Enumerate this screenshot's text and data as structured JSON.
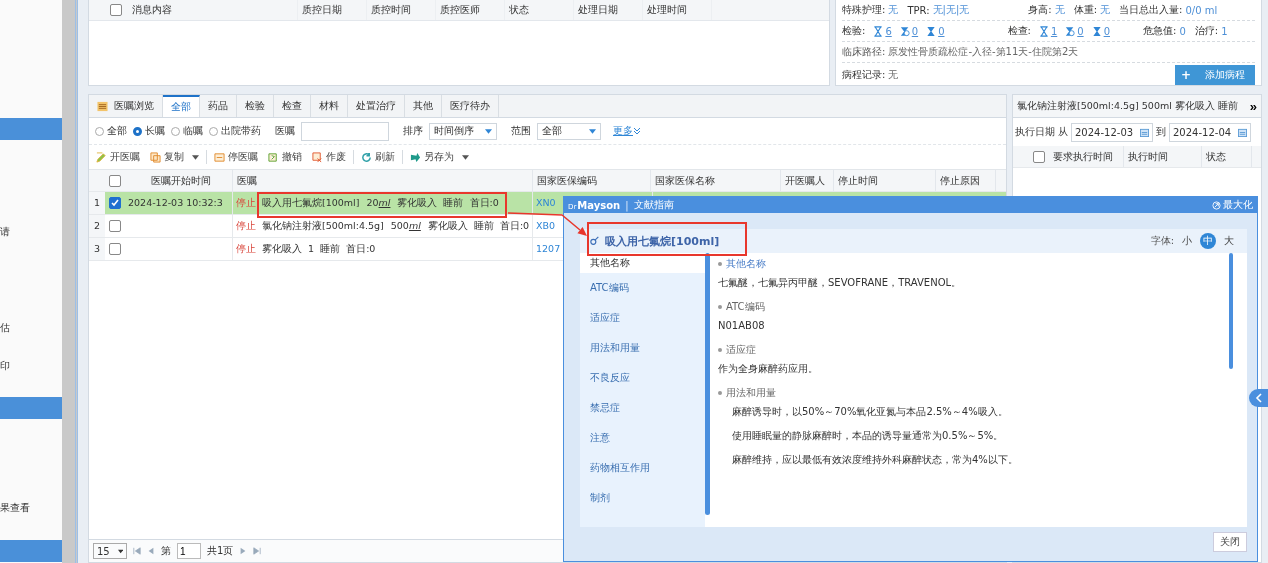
{
  "sidebar": {
    "items": [
      {
        "selected": true
      },
      {
        "label": "请",
        "selected": false
      },
      {
        "label": "估",
        "selected": false
      },
      {
        "label": "印",
        "selected": false
      },
      {
        "selected": true
      },
      {
        "label": "果查看",
        "selected": false
      },
      {
        "selected": true
      }
    ]
  },
  "messages": {
    "select_all": false,
    "columns": [
      "消息内容",
      "质控日期",
      "质控时间",
      "质控医师",
      "状态",
      "处理日期",
      "处理时间"
    ]
  },
  "patient_info": {
    "vitals": [
      {
        "label": "特殊护理:",
        "value": "无"
      },
      {
        "label": "TPR:",
        "value": "无|无|无"
      },
      {
        "label": "身高:",
        "value": "无"
      },
      {
        "label": "体重:",
        "value": "无"
      },
      {
        "label": "当日总出入量:",
        "value": "0/0 ml"
      }
    ],
    "counters": [
      {
        "label": "检验:",
        "counts": [
          {
            "kind": "waiting",
            "value": "6"
          },
          {
            "kind": "running",
            "value": "0"
          },
          {
            "kind": "done",
            "value": "0"
          }
        ]
      },
      {
        "label": "检查:",
        "counts": [
          {
            "kind": "waiting",
            "value": "1"
          },
          {
            "kind": "running",
            "value": "0"
          },
          {
            "kind": "done",
            "value": "0"
          }
        ]
      }
    ],
    "stats": [
      {
        "label": "危急值:",
        "value": "0"
      },
      {
        "label": "治疗:",
        "value": "1"
      }
    ],
    "pathway": {
      "label": "临床路径:",
      "value": "原发性骨质疏松症-入径-第11天-住院第2天"
    },
    "course": {
      "label": "病程记录:",
      "value": "无"
    },
    "add_button": {
      "icon": "+",
      "label": "添加病程"
    }
  },
  "tabs": [
    {
      "label": "医嘱浏览",
      "kind": "title",
      "selected": false
    },
    {
      "label": "全部",
      "kind": "tab",
      "selected": true
    },
    {
      "label": "药品",
      "kind": "tab",
      "selected": false
    },
    {
      "label": "检验",
      "kind": "tab",
      "selected": false
    },
    {
      "label": "检查",
      "kind": "tab",
      "selected": false
    },
    {
      "label": "材料",
      "kind": "tab",
      "selected": false
    },
    {
      "label": "处置治疗",
      "kind": "tab",
      "selected": false
    },
    {
      "label": "其他",
      "kind": "tab",
      "selected": false
    },
    {
      "label": "医疗待办",
      "kind": "tab",
      "selected": false
    }
  ],
  "filters": {
    "radios": [
      {
        "label": "全部",
        "selected": false
      },
      {
        "label": "长嘱",
        "selected": true
      },
      {
        "label": "临嘱",
        "selected": false
      },
      {
        "label": "出院带药",
        "selected": false
      }
    ],
    "search_label": "医嘱",
    "sort_label": "排序",
    "sort_value": "时间倒序",
    "range_label": "范围",
    "range_value": "全部",
    "more_link": "更多"
  },
  "toolbar": [
    {
      "label": "开医嘱",
      "dropdown": false
    },
    {
      "label": "复制",
      "dropdown": true
    },
    {
      "label": "停医嘱",
      "dropdown": false
    },
    {
      "label": "撤销",
      "dropdown": false
    },
    {
      "label": "作废",
      "dropdown": false
    },
    {
      "label": "刷新",
      "dropdown": false
    },
    {
      "label": "另存为",
      "dropdown": true
    }
  ],
  "orders": {
    "select_all": false,
    "columns": [
      "医嘱开始时间",
      "医嘱",
      "国家医保编码",
      "国家医保名称",
      "开医嘱人",
      "停止时间",
      "停止原因"
    ],
    "rows": [
      {
        "num": "1",
        "checked": true,
        "selected": true,
        "start": "2024-12-03 10:32:3",
        "status": "停止",
        "drug": "吸入用七氟烷[100ml]",
        "dose": "20",
        "unit": "ml",
        "usage": "雾化吸入  睡前  首日:0",
        "code": "XN0"
      },
      {
        "num": "2",
        "checked": false,
        "selected": false,
        "status": "停止",
        "drug": "氯化钠注射液[500ml:4.5g]",
        "dose": "500",
        "unit": "ml",
        "usage": "雾化吸入  睡前  首日:0",
        "code": "XB0"
      },
      {
        "num": "3",
        "checked": false,
        "selected": false,
        "status": "停止",
        "drug": "雾化吸入  1  睡前  首日:0",
        "code": "1207"
      }
    ]
  },
  "pager": {
    "page_size": "15",
    "page_prefix": "第",
    "page": "1",
    "total": "共1页"
  },
  "exec_panel": {
    "title": "氯化钠注射液[500ml:4.5g] 500ml 雾化吸入 睡前",
    "expand": "»",
    "date_label": "执行日期",
    "from": "从",
    "from_date": "2024-12-03",
    "to": "到",
    "to_date": "2024-12-04",
    "select_all": false,
    "columns": [
      "要求执行时间",
      "执行时间",
      "状态"
    ]
  },
  "modal": {
    "brand_prefix": "Dr",
    "brand": "Mayson",
    "separator": "|",
    "section": "文献指南",
    "maximize": "最大化",
    "drug": "吸入用七氟烷[100ml]",
    "font_label": "字体:",
    "font_sizes": [
      {
        "label": "小",
        "selected": false
      },
      {
        "label": "中",
        "selected": true
      },
      {
        "label": "大",
        "selected": false
      }
    ],
    "nav": [
      {
        "label": "其他名称",
        "selected": true
      },
      {
        "label": "ATC编码",
        "selected": false
      },
      {
        "label": "适应症",
        "selected": false
      },
      {
        "label": "用法和用量",
        "selected": false
      },
      {
        "label": "不良反应",
        "selected": false
      },
      {
        "label": "禁忌症",
        "selected": false
      },
      {
        "label": "注意",
        "selected": false
      },
      {
        "label": "药物相互作用",
        "selected": false
      },
      {
        "label": "制剂",
        "selected": false
      }
    ],
    "sections": [
      {
        "heading": "其他名称",
        "selected": true,
        "kind": "plain",
        "paragraphs": [
          "七氟醚，七氟异丙甲醚，SEVOFRANE，TRAVENOL。"
        ]
      },
      {
        "heading": "ATC编码",
        "selected": false,
        "kind": "plain",
        "paragraphs": [
          "N01AB08"
        ]
      },
      {
        "heading": "适应症",
        "selected": false,
        "kind": "plain",
        "paragraphs": [
          "作为全身麻醉药应用。"
        ]
      },
      {
        "heading": "用法和用量",
        "selected": false,
        "kind": "indented",
        "paragraphs": [
          "麻醉诱导时，以50%～70%氧化亚氮与本品2.5%～4%吸入。",
          "使用睡眠量的静脉麻醉时，本品的诱导量通常为0.5%～5%。",
          "麻醉维持，应以最低有效浓度维持外科麻醉状态，常为4%以下。"
        ]
      }
    ],
    "close": "关闭"
  }
}
